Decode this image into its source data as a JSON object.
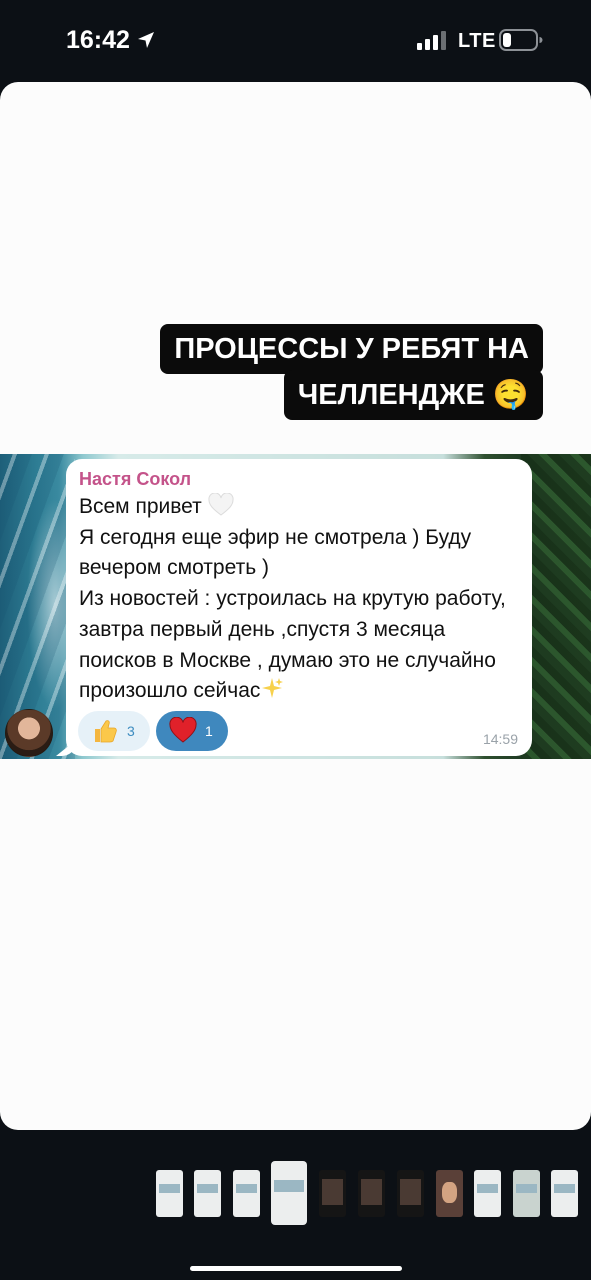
{
  "status_bar": {
    "time": "16:42",
    "network": "LTE",
    "icons": [
      "location-arrow-icon",
      "signal-icon",
      "battery-icon"
    ]
  },
  "story": {
    "caption_line1": "ПРОЦЕССЫ У РЕБЯТ НА",
    "caption_line2": "ЧЕЛЛЕНДЖЕ 🤤"
  },
  "chat": {
    "sender": "Настя Сокол",
    "line1": "Всем привет",
    "line2": "Я сегодня еще эфир не смотрела ) Буду вечером смотреть )",
    "line3": "Из новостей : устроилась на крутую работу, завтра первый день ,спустя 3 месяца поисков в Москве , думаю это не случайно произошло сейчас",
    "reactions": [
      {
        "icon": "thumbs-up-icon",
        "count": "3"
      },
      {
        "icon": "red-heart-icon",
        "count": "1"
      }
    ],
    "time": "14:59"
  },
  "thumbnails": {
    "count": 11,
    "active_index": 3
  },
  "colors": {
    "sender": "#c4538a",
    "reaction_active": "#3f88be",
    "caption_bg": "#0b0b0b"
  }
}
